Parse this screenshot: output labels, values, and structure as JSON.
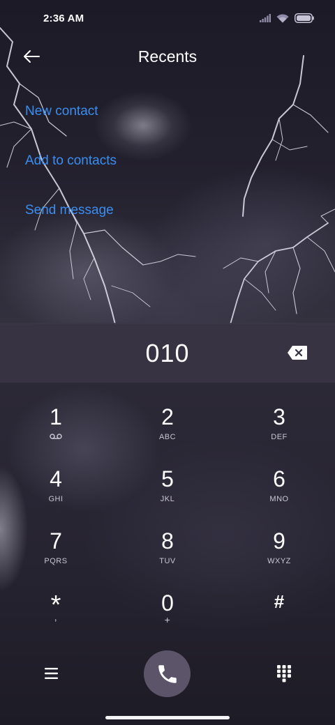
{
  "status_bar": {
    "time": "2:36 AM",
    "icons": [
      "signal-icon",
      "wifi-icon",
      "battery-icon"
    ]
  },
  "header": {
    "title": "Recents",
    "back_icon": "back-arrow-icon"
  },
  "actions": {
    "new_contact": "New contact",
    "add_to_contacts": "Add to contacts",
    "send_message": "Send message"
  },
  "dialer": {
    "number": "010",
    "backspace_icon": "backspace-icon"
  },
  "keypad": {
    "keys": [
      {
        "digit": "1",
        "letters": ""
      },
      {
        "digit": "2",
        "letters": "ABC"
      },
      {
        "digit": "3",
        "letters": "DEF"
      },
      {
        "digit": "4",
        "letters": "GHI"
      },
      {
        "digit": "5",
        "letters": "JKL"
      },
      {
        "digit": "6",
        "letters": "MNO"
      },
      {
        "digit": "7",
        "letters": "PQRS"
      },
      {
        "digit": "8",
        "letters": "TUV"
      },
      {
        "digit": "9",
        "letters": "WXYZ"
      },
      {
        "digit": "*",
        "letters": ","
      },
      {
        "digit": "0",
        "letters": "+"
      },
      {
        "digit": "#",
        "letters": ""
      }
    ],
    "voicemail_icon": "voicemail-icon"
  },
  "bottom_bar": {
    "menu_icon": "menu-icon",
    "call_icon": "phone-icon",
    "dialpad_icon": "dialpad-icon"
  },
  "colors": {
    "link": "#3a8ef2",
    "call_button": "#5c5468",
    "display_bg": "#3a3746"
  }
}
